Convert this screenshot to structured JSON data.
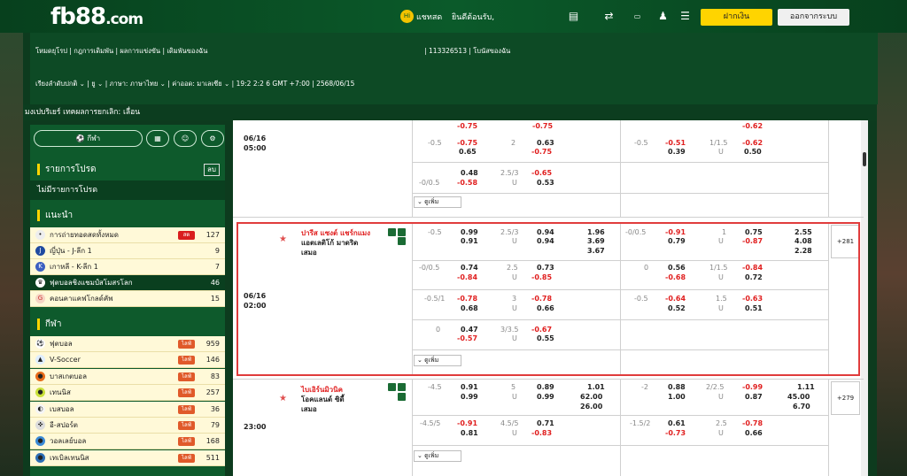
{
  "header": {
    "logo": "fb88",
    "logo_suffix": ".com",
    "chat": "แชทสด",
    "welcome": "ยินดีต้อนรับ,",
    "deposit": "ฝากเงิน",
    "logout": "ออกจากระบบ"
  },
  "nav": {
    "row1": [
      "โหมดยุโรป",
      "กฎการเดิมพัน",
      "ผลการแข่งขัน",
      "เดิมพันของฉัน",
      "113326513",
      "โบนัสของฉัน"
    ],
    "row2": [
      "เรียงลำดับปกติ",
      "ยู",
      "ภาษา: ภาษาไทย",
      "ค่าออด: มาเลเซีย",
      "19:2 2:2 6 GMT +7:00",
      "2568/06/15"
    ]
  },
  "ticker": "มงเปบริเยร์ เทคผลการยกเลิก: เลื่อน",
  "sidebar": {
    "sports_tab": "กีฬา",
    "favorites_title": "รายการโปรด",
    "favorites_btn": "ลบ",
    "favorites_empty": "ไม่มีรายการโปรด",
    "recommended_title": "แนะนำ",
    "recommended": [
      {
        "label": "การถ่ายทอดสดทั้งหมด",
        "count": "127",
        "badge": "สด"
      },
      {
        "label": "ญี่ปุ่น - J-ลีก 1",
        "count": "9"
      },
      {
        "label": "เกาหลี - K-ลีก 1",
        "count": "7"
      },
      {
        "label": "ฟุตบอลชิงแชมป์สโมสรโลก",
        "count": "46"
      },
      {
        "label": "คอนคาแคฟโกลด์คัพ",
        "count": "15"
      }
    ],
    "sports_title": "กีฬา",
    "sports": [
      {
        "label": "ฟุตบอล",
        "count": "959",
        "live": "ไลฟ์"
      },
      {
        "label": "V-Soccer",
        "count": "146",
        "live": "ไลฟ์"
      },
      {
        "label": "บาสเกตบอล",
        "count": "83",
        "live": "ไลฟ์"
      },
      {
        "label": "เทนนิส",
        "count": "257",
        "live": "ไลฟ์"
      },
      {
        "label": "เบสบอล",
        "count": "36",
        "live": "ไลฟ์"
      },
      {
        "label": "อี-สปอร์ต",
        "count": "79",
        "live": "ไลฟ์"
      },
      {
        "label": "วอลเลย์บอล",
        "count": "168",
        "live": "ไลฟ์"
      },
      {
        "label": "เทเบิลเทนนิส",
        "count": "511",
        "live": "ไลฟ์"
      }
    ]
  },
  "matches": {
    "more": "ดูเพิ่ม",
    "m1": {
      "date": "06/16",
      "time": "05:00",
      "r0": [
        "-0.75",
        "-0.75",
        "-0.62"
      ],
      "r1": [
        "-0.5",
        "0.65",
        "2",
        "0.63",
        "-0.5",
        "-0.51",
        "1/1.5",
        "0.39",
        "U",
        "0.50",
        "-0.75",
        "U"
      ],
      "r2": [
        "0.48",
        "2.5/3",
        "-0.65",
        "-0/0.5",
        "-0.58",
        "U",
        "0.53"
      ]
    },
    "m2": {
      "date": "06/16",
      "time": "02:00",
      "home": "ปารีส แซงต์ แชร์กแมง",
      "away": "แอตเลติโก้ มาดริด",
      "draw": "เสมอ",
      "plus": "+281",
      "rows": [
        [
          "-0.5",
          "0.99",
          "2.5/3",
          "0.94",
          "1.96",
          "-0/0.5",
          "-0.91",
          "1",
          "0.75",
          "2.55",
          "0.91",
          "U",
          "0.94",
          "3.69",
          "0.79",
          "U",
          "-0.87",
          "4.08",
          "3.67",
          "2.28"
        ],
        [
          "-0/0.5",
          "0.74",
          "2.5",
          "0.73",
          "0",
          "0.56",
          "1/1.5",
          "-0.84",
          "-0.84",
          "U",
          "-0.85",
          "-0.68",
          "U",
          "0.72"
        ],
        [
          "-0.5/1",
          "-0.78",
          "3",
          "-0.78",
          "-0.5",
          "-0.64",
          "1.5",
          "-0.63",
          "0.68",
          "U",
          "0.66",
          "0.52",
          "U",
          "0.51"
        ],
        [
          "0",
          "0.47",
          "3/3.5",
          "-0.67",
          "-0.57",
          "U",
          "0.55"
        ]
      ]
    },
    "m3": {
      "time": "23:00",
      "home": "ไบเอิร์นมิวนิค",
      "away": "โอคแลนด์ ซิตี้",
      "draw": "เสมอ",
      "plus": "+279",
      "rows": [
        [
          "-4.5",
          "0.91",
          "5",
          "0.89",
          "1.01",
          "-2",
          "0.88",
          "2/2.5",
          "-0.99",
          "1.11",
          "0.99",
          "U",
          "0.99",
          "62.00",
          "1.00",
          "U",
          "0.87",
          "45.00",
          "26.00",
          "6.70"
        ],
        [
          "-4.5/5",
          "-0.91",
          "4.5/5",
          "0.71",
          "-1.5/2",
          "0.61",
          "2.5",
          "-0.78",
          "0.81",
          "U",
          "-0.83",
          "-0.73",
          "U",
          "0.66"
        ]
      ]
    }
  },
  "colors": {
    "header_green": "#0b5a2a",
    "side_green": "#0e5a2c",
    "deposit_yellow": "#ffd400",
    "neg_red": "#e01e1e",
    "highlight": "#e03c3c"
  }
}
